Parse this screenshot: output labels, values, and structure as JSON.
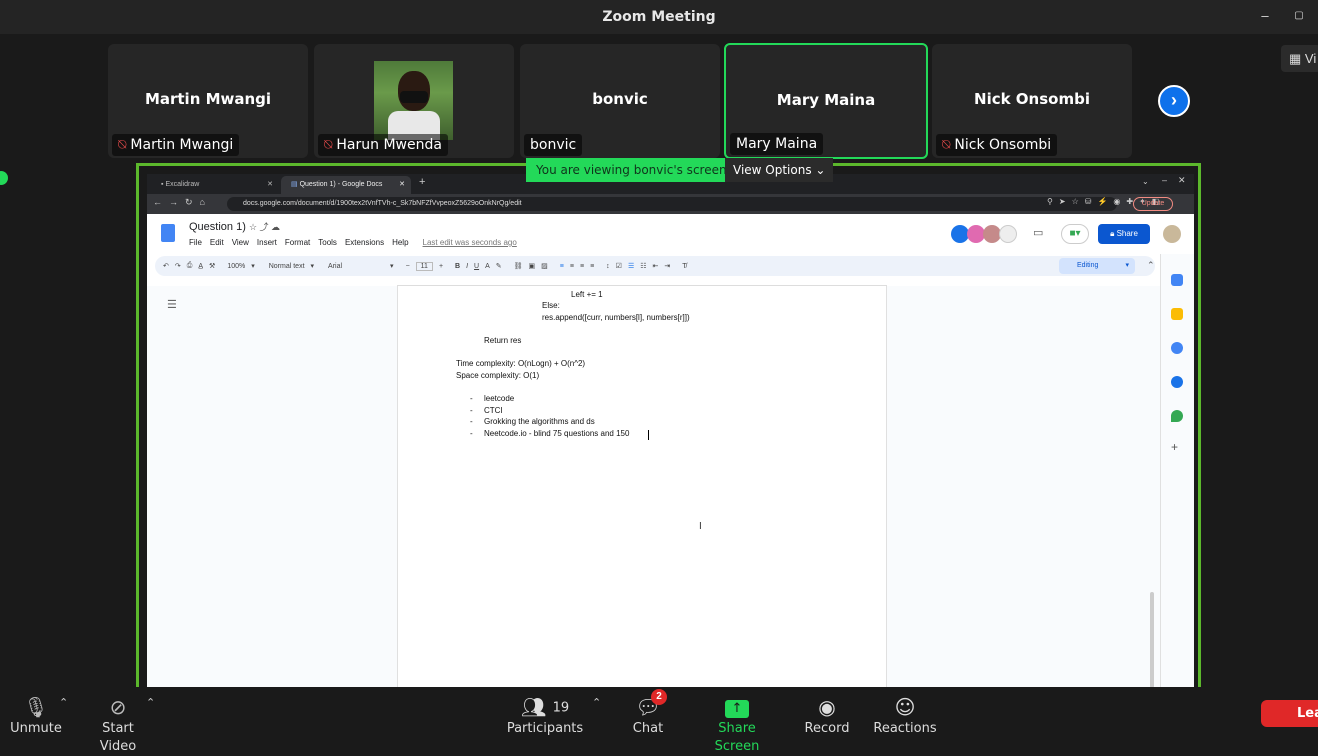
{
  "window": {
    "title": "Zoom Meeting",
    "minimize": "–",
    "close": "▢"
  },
  "gallery": {
    "tiles": [
      {
        "big": "Martin Mwangi",
        "label": "Martin Mwangi",
        "muted": true
      },
      {
        "big": "",
        "label": "Harun Mwenda",
        "muted": true,
        "video": true
      },
      {
        "big": "bonvic",
        "label": "bonvic",
        "muted": false
      },
      {
        "big": "Mary Maina",
        "label": "Mary Maina",
        "muted": false,
        "active": true
      },
      {
        "big": "Nick Onsombi",
        "label": "Nick Onsombi",
        "muted": true
      }
    ],
    "next_icon": "›",
    "view_label": "Vi"
  },
  "share": {
    "banner": "You are viewing bonvic's screen",
    "view_options": "View Options"
  },
  "browser": {
    "tabs": [
      {
        "title": "Excalidraw"
      },
      {
        "title": "Question 1) - Google Docs"
      }
    ],
    "new_tab": "+",
    "url": "docs.google.com/document/d/1900tex2tVnfTVh-c_Sk7bNFZfVvpeoxZ5629oOnkNrQg/edit",
    "update": "Update"
  },
  "docs": {
    "title": "Question 1)",
    "menus": [
      "File",
      "Edit",
      "View",
      "Insert",
      "Format",
      "Tools",
      "Extensions",
      "Help"
    ],
    "last_edit": "Last edit was seconds ago",
    "share": "Share",
    "toolbar": {
      "zoom": "100%",
      "style": "Normal text",
      "font": "Arial",
      "size": "11",
      "editing": "Editing"
    },
    "lines": [
      "Left += 1",
      "Else:",
      "res.append([curr, numbers[l], numbers[r]])",
      "Return res",
      "Time complexity: O(nLogn) + O(n^2)",
      "Space complexity: O(1)",
      "leetcode",
      "CTCI",
      "Grokking the algorithms and ds",
      "Neetcode.io - blind 75 questions and 150"
    ],
    "bullet": "-"
  },
  "bottom": {
    "unmute": "Unmute",
    "start_video": "Start Video",
    "participants": "Participants",
    "participants_count": "19",
    "chat": "Chat",
    "chat_badge": "2",
    "share_screen": "Share Screen",
    "record": "Record",
    "reactions": "Reactions",
    "leave": "Leave"
  },
  "colors": {
    "accent_green": "#23d959",
    "zoom_blue": "#0e71eb",
    "leave_red": "#e02828",
    "share_frame": "#5cb82c"
  }
}
